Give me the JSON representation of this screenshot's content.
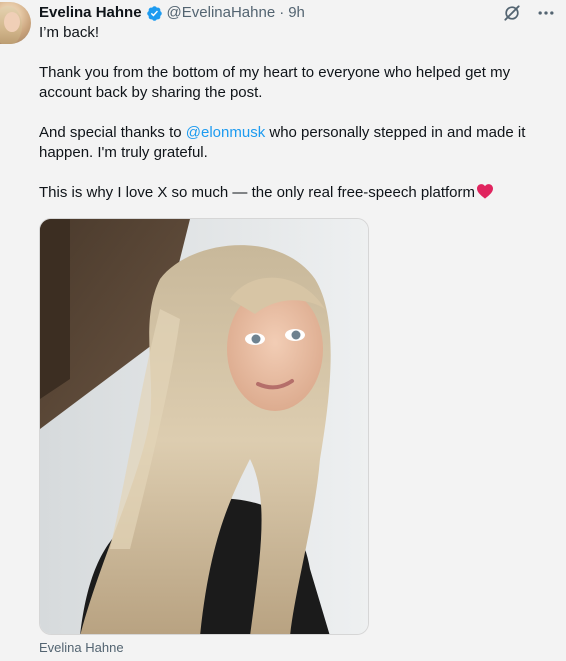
{
  "author": {
    "display_name": "Evelina Hahne",
    "handle": "@EvelinaHahne",
    "separator": "·",
    "time": "9h"
  },
  "icons": {
    "verified": "verified-badge-icon",
    "grok": "grok-icon",
    "more": "more-icon",
    "heart": "red-heart-icon"
  },
  "colors": {
    "verified": "#1d9bf0",
    "mention": "#1d9bf0",
    "heart": "#e0245e"
  },
  "tweet": {
    "line1": "I’m back!",
    "line2": "Thank you from the bottom of my heart to everyone who helped get my account back by sharing the post.",
    "line3_before": "And special thanks to ",
    "line3_mention": "@elonmusk",
    "line3_after": " who personally stepped in and made it happen. I'm truly grateful.",
    "line4": "This is why I love X so much — the only real free-speech platform"
  },
  "media": {
    "caption": "Evelina Hahne"
  }
}
